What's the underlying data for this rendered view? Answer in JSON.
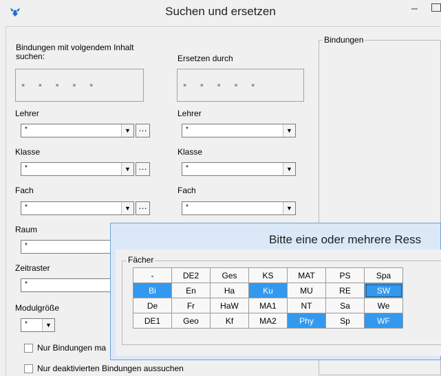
{
  "window": {
    "title": "Suchen und ersetzen",
    "minimize_glyph": "–"
  },
  "search": {
    "label_line1": "Bindungen mit volgendem Inhalt",
    "label_line2": "suchen:",
    "pattern": "× × × × ×"
  },
  "replace": {
    "label": "Ersetzen durch",
    "pattern": "× × × × ×"
  },
  "left_fields": [
    {
      "label": "Lehrer",
      "value": "*"
    },
    {
      "label": "Klasse",
      "value": "*"
    },
    {
      "label": "Fach",
      "value": "*"
    },
    {
      "label": "Raum",
      "value": "*"
    },
    {
      "label": "Zeitraster",
      "value": "*"
    },
    {
      "label": "Modulgröße",
      "value": "*"
    }
  ],
  "right_fields": [
    {
      "label": "Lehrer",
      "value": "*"
    },
    {
      "label": "Klasse",
      "value": "*"
    },
    {
      "label": "Fach",
      "value": "*"
    }
  ],
  "dots_label": "…",
  "checkboxes": [
    {
      "label": "Nur Bindungen ma",
      "checked": false
    },
    {
      "label": "Nur deaktivierten Bindungen aussuchen",
      "checked": false
    }
  ],
  "bindungen_group": {
    "caption": "Bindungen"
  },
  "popup": {
    "title": "Bitte eine oder mehrere Ress",
    "group_caption": "Fächer",
    "grid": [
      [
        {
          "t": "-",
          "s": false
        },
        {
          "t": "DE2",
          "s": false
        },
        {
          "t": "Ges",
          "s": false
        },
        {
          "t": "KS",
          "s": false
        },
        {
          "t": "MAT",
          "s": false
        },
        {
          "t": "PS",
          "s": false
        },
        {
          "t": "Spa",
          "s": false
        }
      ],
      [
        {
          "t": "Bi",
          "s": true
        },
        {
          "t": "En",
          "s": false
        },
        {
          "t": "Ha",
          "s": false
        },
        {
          "t": "Ku",
          "s": true
        },
        {
          "t": "MU",
          "s": false
        },
        {
          "t": "RE",
          "s": false
        },
        {
          "t": "SW",
          "s": true
        }
      ],
      [
        {
          "t": "De",
          "s": false
        },
        {
          "t": "Fr",
          "s": false
        },
        {
          "t": "HaW",
          "s": false
        },
        {
          "t": "MA1",
          "s": false
        },
        {
          "t": "NT",
          "s": false
        },
        {
          "t": "Sa",
          "s": false
        },
        {
          "t": "We",
          "s": false
        }
      ],
      [
        {
          "t": "DE1",
          "s": false
        },
        {
          "t": "Geo",
          "s": false
        },
        {
          "t": "Kf",
          "s": false
        },
        {
          "t": "MA2",
          "s": false
        },
        {
          "t": "Phy",
          "s": true
        },
        {
          "t": "Sp",
          "s": false
        },
        {
          "t": "WF",
          "s": true
        }
      ]
    ],
    "selected_color": "#3399ee"
  }
}
